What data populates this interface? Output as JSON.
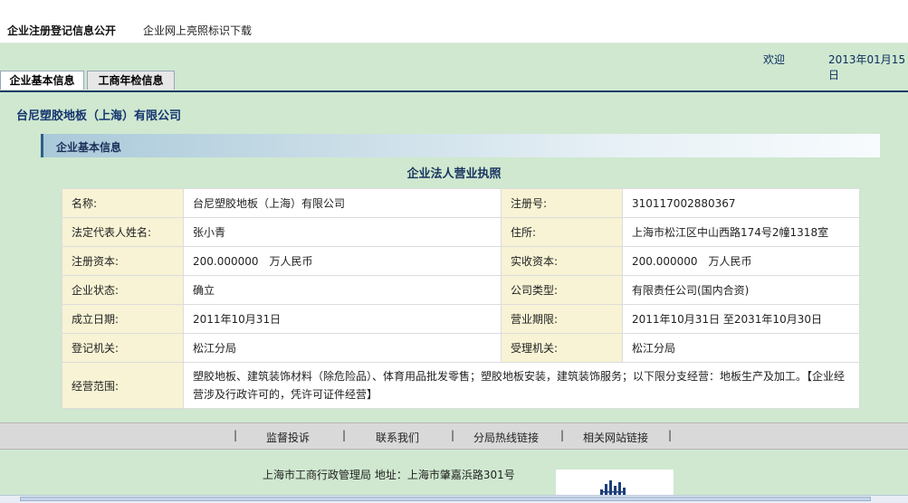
{
  "top_nav": {
    "primary": "企业注册登记信息公开",
    "secondary": "企业网上亮照标识下载"
  },
  "status": {
    "welcome": "欢迎",
    "date": "2013年01月15日"
  },
  "tabs": [
    {
      "label": "企业基本信息",
      "active": true
    },
    {
      "label": "工商年检信息",
      "active": false
    }
  ],
  "company_name": "台尼塑胶地板（上海）有限公司",
  "section_title": "企业基本信息",
  "document_title": "企业法人营业执照",
  "fields": {
    "name_label": "名称:",
    "name_value": "台尼塑胶地板（上海）有限公司",
    "reg_no_label": "注册号:",
    "reg_no_value": "310117002880367",
    "legal_rep_label": "法定代表人姓名:",
    "legal_rep_value": "张小青",
    "address_label": "住所:",
    "address_value": "上海市松江区中山西路174号2幢1318室",
    "reg_capital_label": "注册资本:",
    "reg_capital_value": "200.000000　万人民币",
    "paid_capital_label": "实收资本:",
    "paid_capital_value": "200.000000　万人民币",
    "status_label": "企业状态:",
    "status_value": "确立",
    "company_type_label": "公司类型:",
    "company_type_value": "有限责任公司(国内合资)",
    "founded_label": "成立日期:",
    "founded_value": "2011年10月31日",
    "term_label": "营业期限:",
    "term_value": "2011年10月31日 至2031年10月30日",
    "reg_authority_label": "登记机关:",
    "reg_authority_value": "松江分局",
    "accept_authority_label": "受理机关:",
    "accept_authority_value": "松江分局",
    "scope_label": "经营范围:",
    "scope_value": "塑胶地板、建筑装饰材料（除危险品）、体育用品批发零售；塑胶地板安装，建筑装饰服务；以下限分支经营：地板生产及加工。【企业经营涉及行政许可的，凭许可证件经营】"
  },
  "footer_links": {
    "separator": "|",
    "complaint": "监督投诉",
    "contact": "联系我们",
    "hotline": "分局热线链接",
    "related": "相关网站链接"
  },
  "footer_address": "上海市工商行政管理局 地址：上海市肇嘉浜路301号",
  "logo_icon": "building-logo-icon"
}
